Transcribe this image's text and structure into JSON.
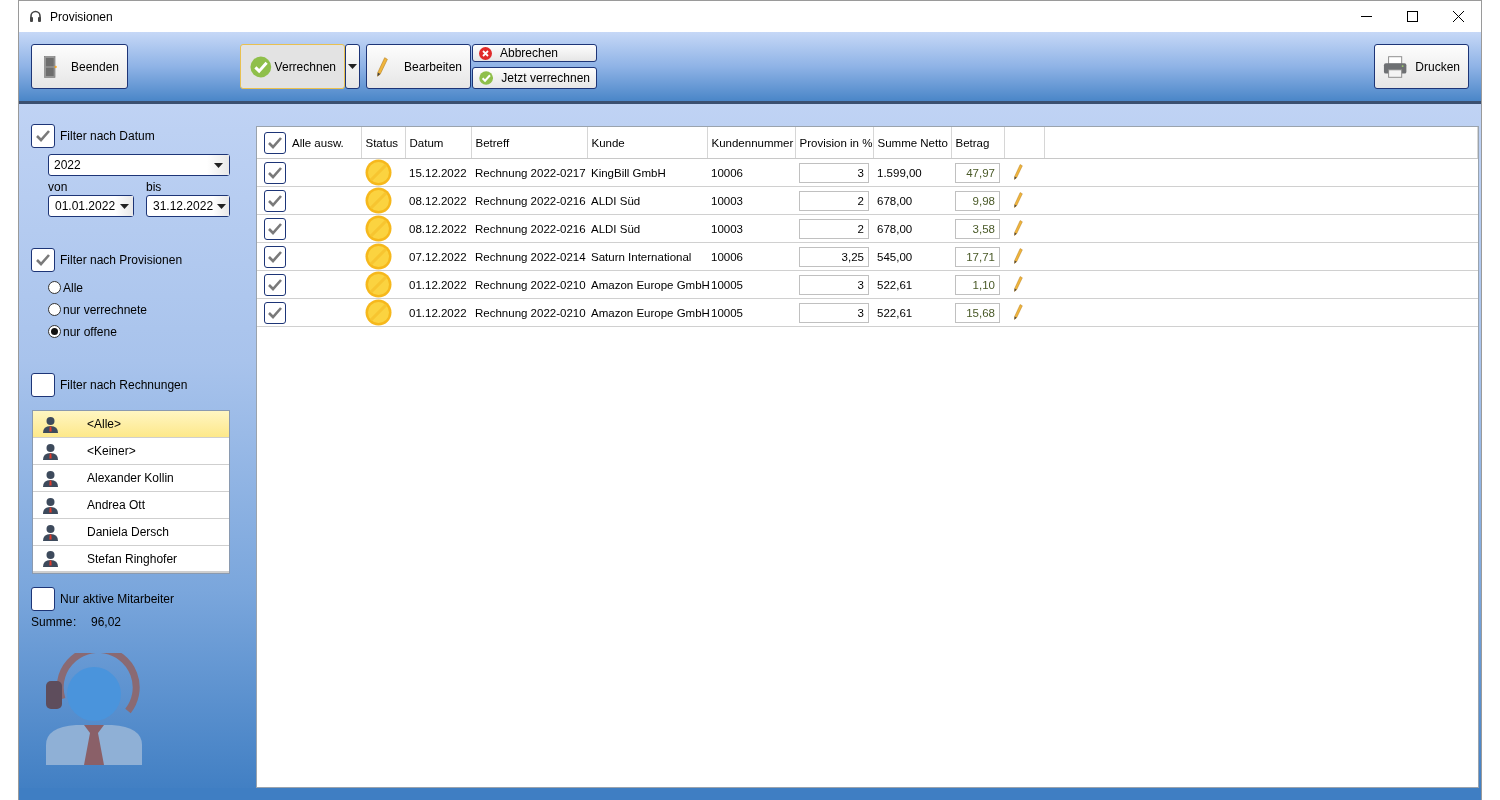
{
  "window": {
    "title": "Provisionen"
  },
  "toolbar": {
    "exit": {
      "label": "Beenden"
    },
    "settle": {
      "label": "Verrechnen",
      "pressed": true
    },
    "edit": {
      "label": "Bearbeiten"
    },
    "cancel": {
      "label": "Abbrechen"
    },
    "settle_now": {
      "label": "Jetzt verrechnen"
    },
    "print": {
      "label": "Drucken"
    }
  },
  "sidebar": {
    "date_filter": {
      "label": "Filter nach Datum",
      "checked": true,
      "year": "2022",
      "from_label": "von",
      "from": "01.01.2022",
      "to_label": "bis",
      "to": "31.12.2022"
    },
    "commission_filter": {
      "label": "Filter nach Provisionen",
      "checked": true,
      "options": [
        {
          "label": "Alle",
          "selected": false
        },
        {
          "label": "nur verrechnete",
          "selected": false
        },
        {
          "label": "nur offene",
          "selected": true
        }
      ]
    },
    "invoice_filter": {
      "label": "Filter nach Rechnungen",
      "checked": false
    },
    "employees": [
      {
        "name": "<Alle>",
        "selected": true
      },
      {
        "name": "<Keiner>",
        "selected": false
      },
      {
        "name": "Alexander Kollin",
        "selected": false
      },
      {
        "name": "Andrea Ott",
        "selected": false
      },
      {
        "name": "Daniela Dersch",
        "selected": false
      },
      {
        "name": "Stefan Ringhofer",
        "selected": false
      }
    ],
    "active_only": {
      "label": "Nur aktive Mitarbeiter",
      "checked": false
    },
    "sum": {
      "label": "Summe",
      "separator": ":",
      "value": "96,02"
    }
  },
  "table": {
    "select_all": {
      "label": "Alle ausw.",
      "checked": true
    },
    "columns": [
      "Status",
      "Datum",
      "Betreff",
      "Kunde",
      "Kundennummer",
      "Provision in %",
      "Summe Netto",
      "Betrag"
    ],
    "rows": [
      {
        "checked": true,
        "date": "15.12.2022",
        "subject": "Rechnung 2022-0217",
        "customer": "KingBill GmbH",
        "customer_no": "10006",
        "commission": "3",
        "net": "1.599,00",
        "amount": "47,97"
      },
      {
        "checked": true,
        "date": "08.12.2022",
        "subject": "Rechnung 2022-0216",
        "customer": "ALDI Süd",
        "customer_no": "10003",
        "commission": "2",
        "net": "678,00",
        "amount": "9,98"
      },
      {
        "checked": true,
        "date": "08.12.2022",
        "subject": "Rechnung 2022-0216",
        "customer": "ALDI Süd",
        "customer_no": "10003",
        "commission": "2",
        "net": "678,00",
        "amount": "3,58"
      },
      {
        "checked": true,
        "date": "07.12.2022",
        "subject": "Rechnung 2022-0214",
        "customer": "Saturn International",
        "customer_no": "10006",
        "commission": "3,25",
        "net": "545,00",
        "amount": "17,71"
      },
      {
        "checked": true,
        "date": "01.12.2022",
        "subject": "Rechnung 2022-0210",
        "customer": "Amazon Europe GmbH",
        "customer_no": "10005",
        "commission": "3",
        "net": "522,61",
        "amount": "1,10"
      },
      {
        "checked": true,
        "date": "01.12.2022",
        "subject": "Rechnung 2022-0210",
        "customer": "Amazon Europe GmbH",
        "customer_no": "10005",
        "commission": "3",
        "net": "522,61",
        "amount": "15,68"
      }
    ]
  }
}
